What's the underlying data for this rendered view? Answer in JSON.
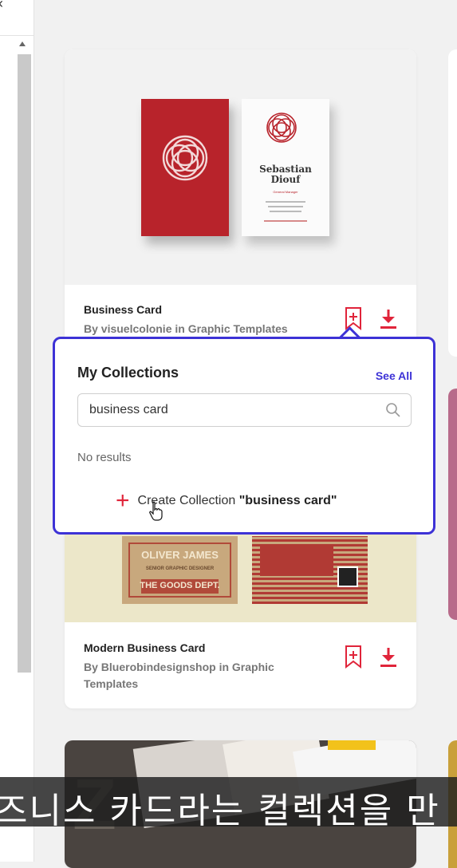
{
  "nav": {
    "back_icon": "chevron-left-icon"
  },
  "cards": [
    {
      "title": "Business Card",
      "author": "By visuelcolonie in Graphic Templates"
    },
    {
      "title": "Modern Business Card",
      "author": "By Bluerobindesignshop in Graphic Templates"
    }
  ],
  "card1_preview": {
    "name_line1": "Sebastian",
    "name_line2": "Diouf",
    "role": "General Manager"
  },
  "card2_preview": {
    "name": "OLIVER JAMES",
    "tag": "SENIOR GRAPHIC DESIGNER",
    "company": "THE GOODS DEPT."
  },
  "popup": {
    "title": "My Collections",
    "see_all": "See All",
    "search_value": "business card",
    "empty_text": "No results",
    "create_label": "Create Collection",
    "create_name": "\"business card\""
  },
  "subtitle": "즈니스 카드라는 컬렉션을 만",
  "colors": {
    "accent": "#3d32d6",
    "action_red": "#e0243a"
  }
}
